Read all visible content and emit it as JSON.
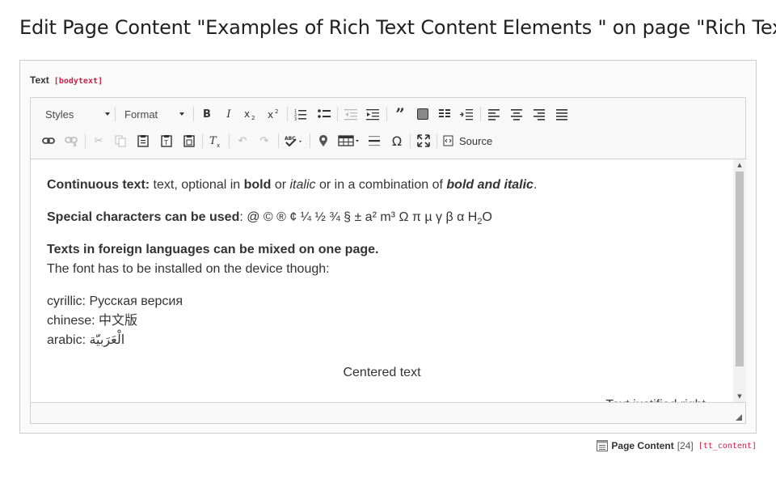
{
  "page": {
    "title": "Edit Page Content \"Examples of Rich Text Content Elements \" on page \"Rich Text\""
  },
  "field": {
    "label": "Text",
    "code": "[bodytext]"
  },
  "toolbar": {
    "styles_label": "Styles",
    "format_label": "Format",
    "source_label": "Source",
    "buttons_row1": [
      "bold",
      "italic",
      "subscript",
      "superscript",
      "numbered-list",
      "bulleted-list",
      "outdent",
      "indent",
      "blockquote",
      "div",
      "columns",
      "paragraph-direction",
      "align-left",
      "align-center",
      "align-right",
      "align-justify"
    ],
    "buttons_row2": [
      "link",
      "unlink",
      "cut",
      "copy",
      "paste",
      "paste-text",
      "paste-word",
      "remove-format",
      "undo",
      "redo",
      "spellcheck",
      "anchor",
      "table",
      "horizontal-rule",
      "special-char",
      "maximize",
      "source"
    ]
  },
  "content": {
    "p1_bold": "Continuous text:",
    "p1_text1": " text, optional in ",
    "p1_bold2": "bold",
    "p1_text2": " or ",
    "p1_italic": "italic",
    "p1_text3": " or in a combination of ",
    "p1_bolditalic": "bold and italic",
    "p1_end": ".",
    "p2_bold": "Special characters can be used",
    "p2_text": ": @ © ® ¢ ¼ ½ ¾ § ± a² m³ Ω π µ γ β α H",
    "p2_sub": "2",
    "p2_end": "O",
    "p3_bold": "Texts in foreign languages can be mixed on one page.",
    "p3_text": "The font has to be installed on the device though:",
    "lang_cyrillic": "cyrillic: Русская версия",
    "lang_chinese": "chinese: 中文版",
    "lang_arabic": "arabic: الْعَرَبيّة",
    "centered": "Centered text",
    "right_aligned": "Text justified right"
  },
  "footer": {
    "label": "Page Content",
    "count": "[24]",
    "table": "[tt_content]"
  },
  "colors": {
    "code_accent": "#c7254e",
    "toolbar_bg": "#f8f8f8",
    "border": "#d1d1d1"
  }
}
